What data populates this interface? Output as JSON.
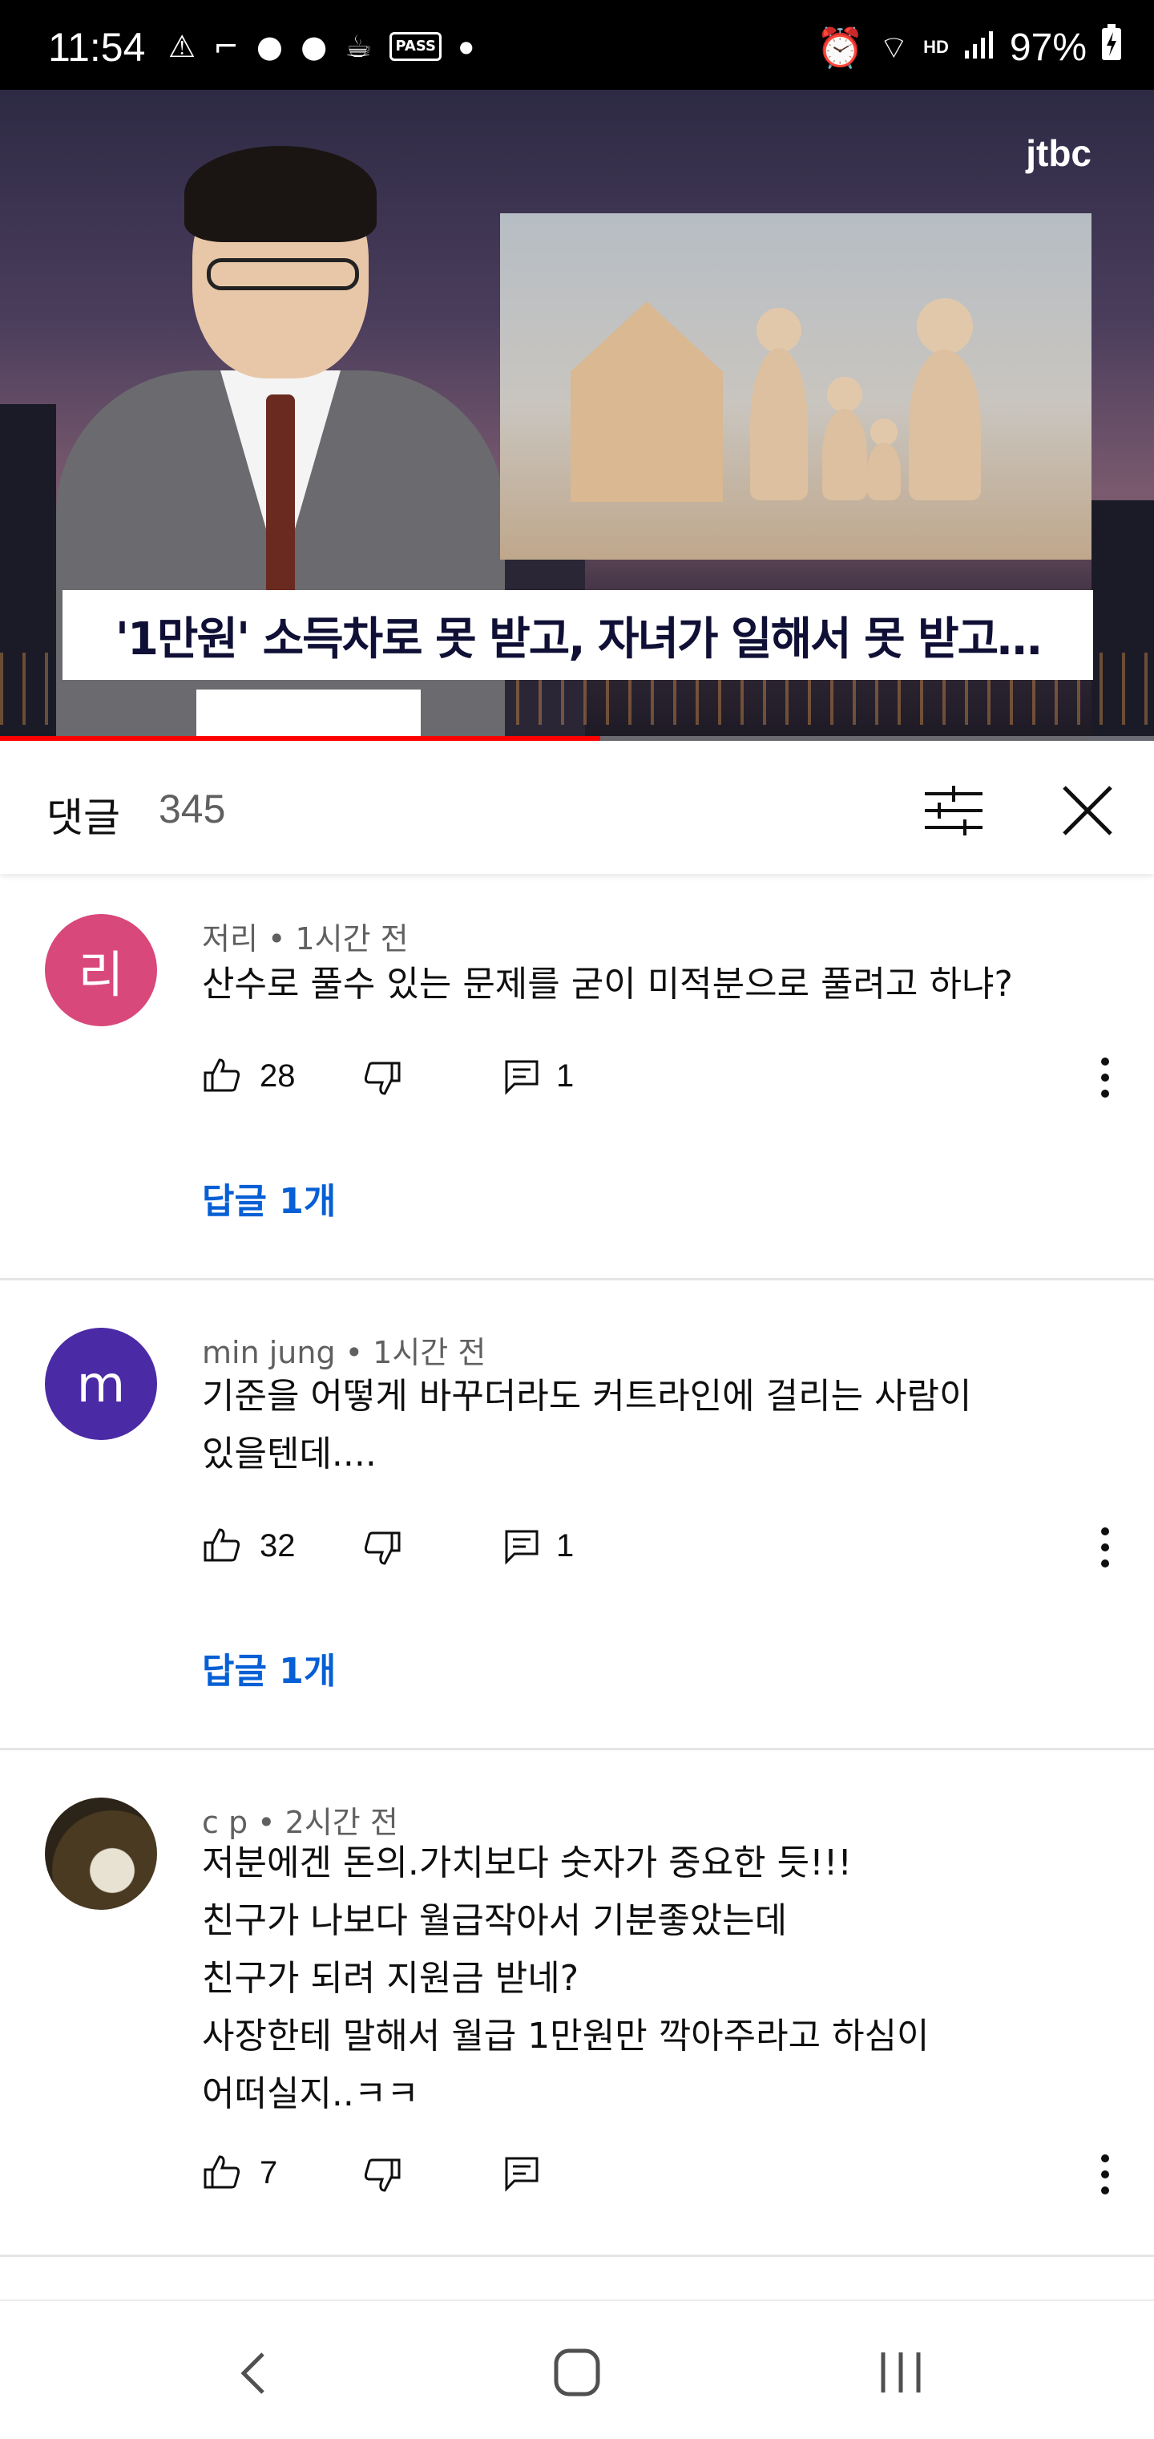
{
  "status_bar": {
    "time": "11:54",
    "battery": "97%",
    "hd_label": "HD",
    "pass_label": "PASS"
  },
  "video": {
    "channel_logo": "jtbc",
    "caption": "'1만원' 소득차로 못 받고, 자녀가 일해서 못 받고…",
    "progress": 0.52
  },
  "comments_header": {
    "title": "댓글",
    "count": "345"
  },
  "comments": [
    {
      "author": "저리",
      "time": "1시간 전",
      "avatar_letter": "리",
      "avatar_color": "#d9487a",
      "text_lines": [
        "산수로 풀수 있는 문제를 굳이 미적분으로 풀려고 하냐?"
      ],
      "likes": "28",
      "replies": "1",
      "replies_link": "답글 1개"
    },
    {
      "author": "min jung",
      "time": "1시간 전",
      "avatar_letter": "m",
      "avatar_color": "#4b2aa6",
      "text_lines": [
        "기준을 어떻게 바꾸더라도 커트라인에 걸리는 사람이",
        "있을텐데...."
      ],
      "likes": "32",
      "replies": "1",
      "replies_link": "답글 1개"
    },
    {
      "author": "c p",
      "time": "2시간 전",
      "avatar_letter": "",
      "avatar_color": "#5a4a2e",
      "text_lines": [
        "저분에겐 돈의.가치보다 숫자가 중요한 듯!!!",
        "친구가  나보다 월급작아서 기분좋았는데",
        "친구가 되려 지원금 받네?",
        "사장한테 말해서 월급 1만원만 깍아주라고 하심이",
        "어떠실지..ㅋㅋ"
      ],
      "likes": "7",
      "replies": "",
      "replies_link": ""
    }
  ],
  "icons": {
    "like": "thumbs-up-icon",
    "dislike": "thumbs-down-icon",
    "reply": "reply-icon",
    "more": "more-vert-icon",
    "filter": "filter-sliders-icon",
    "close": "close-icon"
  },
  "colors": {
    "link_blue": "#065fd4",
    "progress_red": "#ff0000"
  }
}
